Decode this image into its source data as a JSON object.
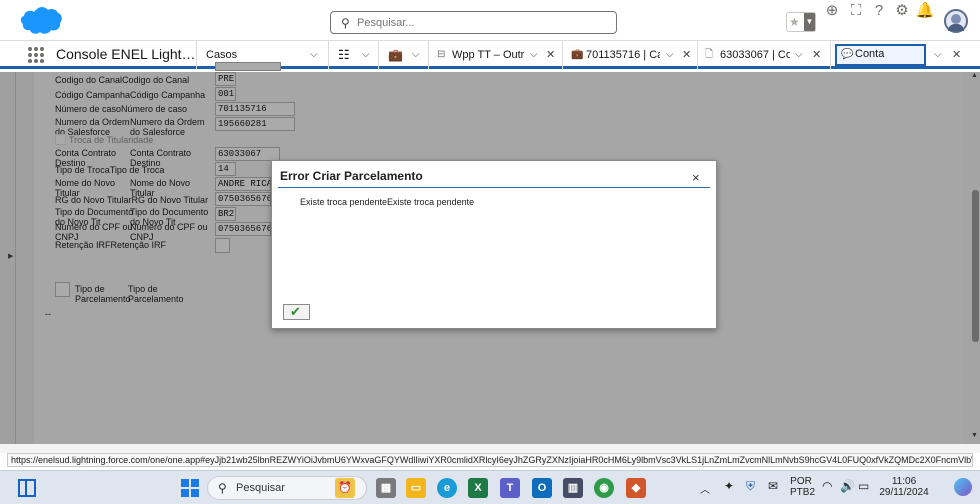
{
  "header": {
    "search_placeholder": "Pesquisar...",
    "icons": [
      "favorites-star-icon",
      "add-icon",
      "setup-assistant-icon",
      "help-icon",
      "gear-icon",
      "notifications-bell-icon"
    ]
  },
  "nav": {
    "app_name": "Console ENEL Light…",
    "object_selector": "Casos",
    "tabs": [
      {
        "label": "Wpp TT – Outr…"
      },
      {
        "label": "701135716 | Ca…"
      },
      {
        "label": "63033067 | Co…"
      }
    ],
    "active_tab": "Conta"
  },
  "form": {
    "fields": [
      {
        "label": "Codigo do CanalCodigo do Canal",
        "value": "PRE"
      },
      {
        "label": "Código CampanhaCódigo Campanha",
        "value": "001"
      },
      {
        "label": "Número de casoNúmero de caso",
        "value": "701135716"
      },
      {
        "label": "Numero da Ordem\ndo Salesforce",
        "label2": "Numero da Ordem\ndo Salesforce",
        "value": "195660281"
      },
      {
        "label": "Troca de Titularidade"
      },
      {
        "label": "Conta Contrato\nDestino",
        "label2": "Conta Contrato\nDestino",
        "value": "63033067"
      },
      {
        "label": "Tipo de TrocaTipo de Troca",
        "value": "14"
      },
      {
        "label": "Nome do Novo\nTitular",
        "label2": "Nome do Novo\nTitular",
        "value": "ANDRE RICA"
      },
      {
        "label": "RG do Novo TitularRG do Novo Titular",
        "value": "07503656760"
      },
      {
        "label": "Tipo do Documento\ndo Novo Tit",
        "label2": "Tipo do Documento\ndo Novo Tit",
        "value": "BR2"
      },
      {
        "label": "Numero do CPF ou\nCNPJ",
        "label2": "Numero do CPF ou\nCNPJ",
        "value": "07503656760"
      },
      {
        "label": "Retenção IRFRetenção IRF"
      },
      {
        "label": "Tipo de\nParcelamento",
        "label2": "Tipo de\nParcelamento"
      }
    ],
    "footer_text": "--"
  },
  "modal": {
    "title": "Error Criar Parcelamento",
    "message": "Existe troca pendenteExiste troca pendente",
    "close": "×",
    "ok": "✔"
  },
  "statusbar": {
    "url": "https://enelsud.lightning.force.com/one/one.app#eyJjb21wb25lbnREZWYiOiJvbmU6YWxvaGFQYWdlIiwiYXR0cmlidXRlcyI6eyJhZGRyZXNzIjoiaHR0cHM6Ly9lbmVsc3VkLS1jLnZmLmZvcmNlLmNvbS9hcGV4L0FUQ0xfVkZQMDc2X0FncmVlbWVudFJlcXVl..."
  },
  "taskbar": {
    "search_label": "Pesquisar",
    "language_top": "POR",
    "language_bottom": "PTB2",
    "time": "11:06",
    "date": "29/11/2024",
    "apps": [
      {
        "name": "file-explorer",
        "color": "#f3b51b"
      },
      {
        "name": "edge",
        "color": "#1a9bd8"
      },
      {
        "name": "excel",
        "color": "#1d7a44",
        "letter": "X"
      },
      {
        "name": "teams",
        "color": "#5b5fc7",
        "letter": "T"
      },
      {
        "name": "outlook",
        "color": "#0f6cbd",
        "letter": "O"
      },
      {
        "name": "calculator",
        "color": "#454c66"
      },
      {
        "name": "chrome",
        "color": "#2f9a4a"
      },
      {
        "name": "app-orange",
        "color": "#d1572a"
      }
    ]
  },
  "colors": {
    "brand": "#1b5fad",
    "salesforce_cloud": "#1b96ff",
    "overlay": "#a7a7a7"
  }
}
